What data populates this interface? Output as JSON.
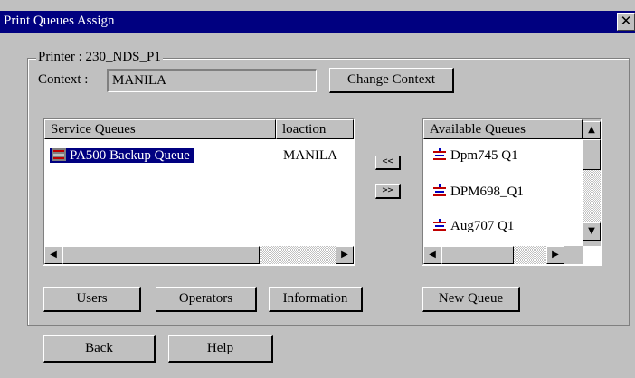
{
  "window": {
    "title": "Print Queues Assign",
    "close_glyph": "✕"
  },
  "printer": {
    "label": "Printer : 230_NDS_P1"
  },
  "context": {
    "label": "Context :",
    "value": "MANILA",
    "change_button": "Change Context"
  },
  "service_queues": {
    "headers": [
      "Service Queues",
      "loaction"
    ],
    "rows": [
      {
        "name": "PA500 Backup Queue",
        "location": "MANILA",
        "selected": true
      }
    ]
  },
  "transfer": {
    "add": "<<",
    "remove": ">>"
  },
  "available_queues": {
    "header": "Available Queues",
    "items": [
      "Dpm745 Q1",
      "DPM698_Q1",
      "Aug707 Q1"
    ]
  },
  "buttons": {
    "users": "Users",
    "operators": "Operators",
    "information": "Information",
    "new_queue": "New Queue",
    "back": "Back",
    "help": "Help"
  },
  "icons": {
    "queue": "print-queue-icon",
    "close": "close-icon"
  },
  "colors": {
    "titlebar": "#000080",
    "selection": "#000080",
    "queue_icon_red": "#c00000",
    "queue_icon_blue": "#0000c0"
  }
}
